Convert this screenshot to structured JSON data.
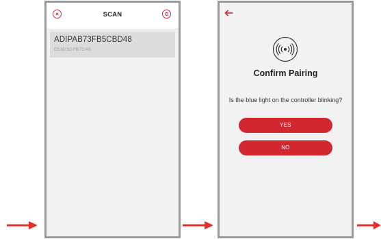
{
  "scan_screen": {
    "title": "SCAN",
    "device": {
      "name": "ADIPAB73FB5CBD48",
      "mac": "C8:8D:5C:FB:73:AB"
    }
  },
  "confirm_screen": {
    "title": "Confirm Pairing",
    "question": "Is the blue light on the controller blinking?",
    "yes_label": "YES",
    "no_label": "NO"
  },
  "icons": {
    "close": "close-icon",
    "refresh": "refresh-icon",
    "back": "back-arrow-icon",
    "pairing": "wireless-signal-icon",
    "flow_arrow": "right-arrow-icon"
  },
  "colors": {
    "accent": "#d3272f",
    "frame": "#9a9a9a",
    "screen_bg": "#f2f2f2",
    "list_item_bg": "#dcdcdc"
  }
}
